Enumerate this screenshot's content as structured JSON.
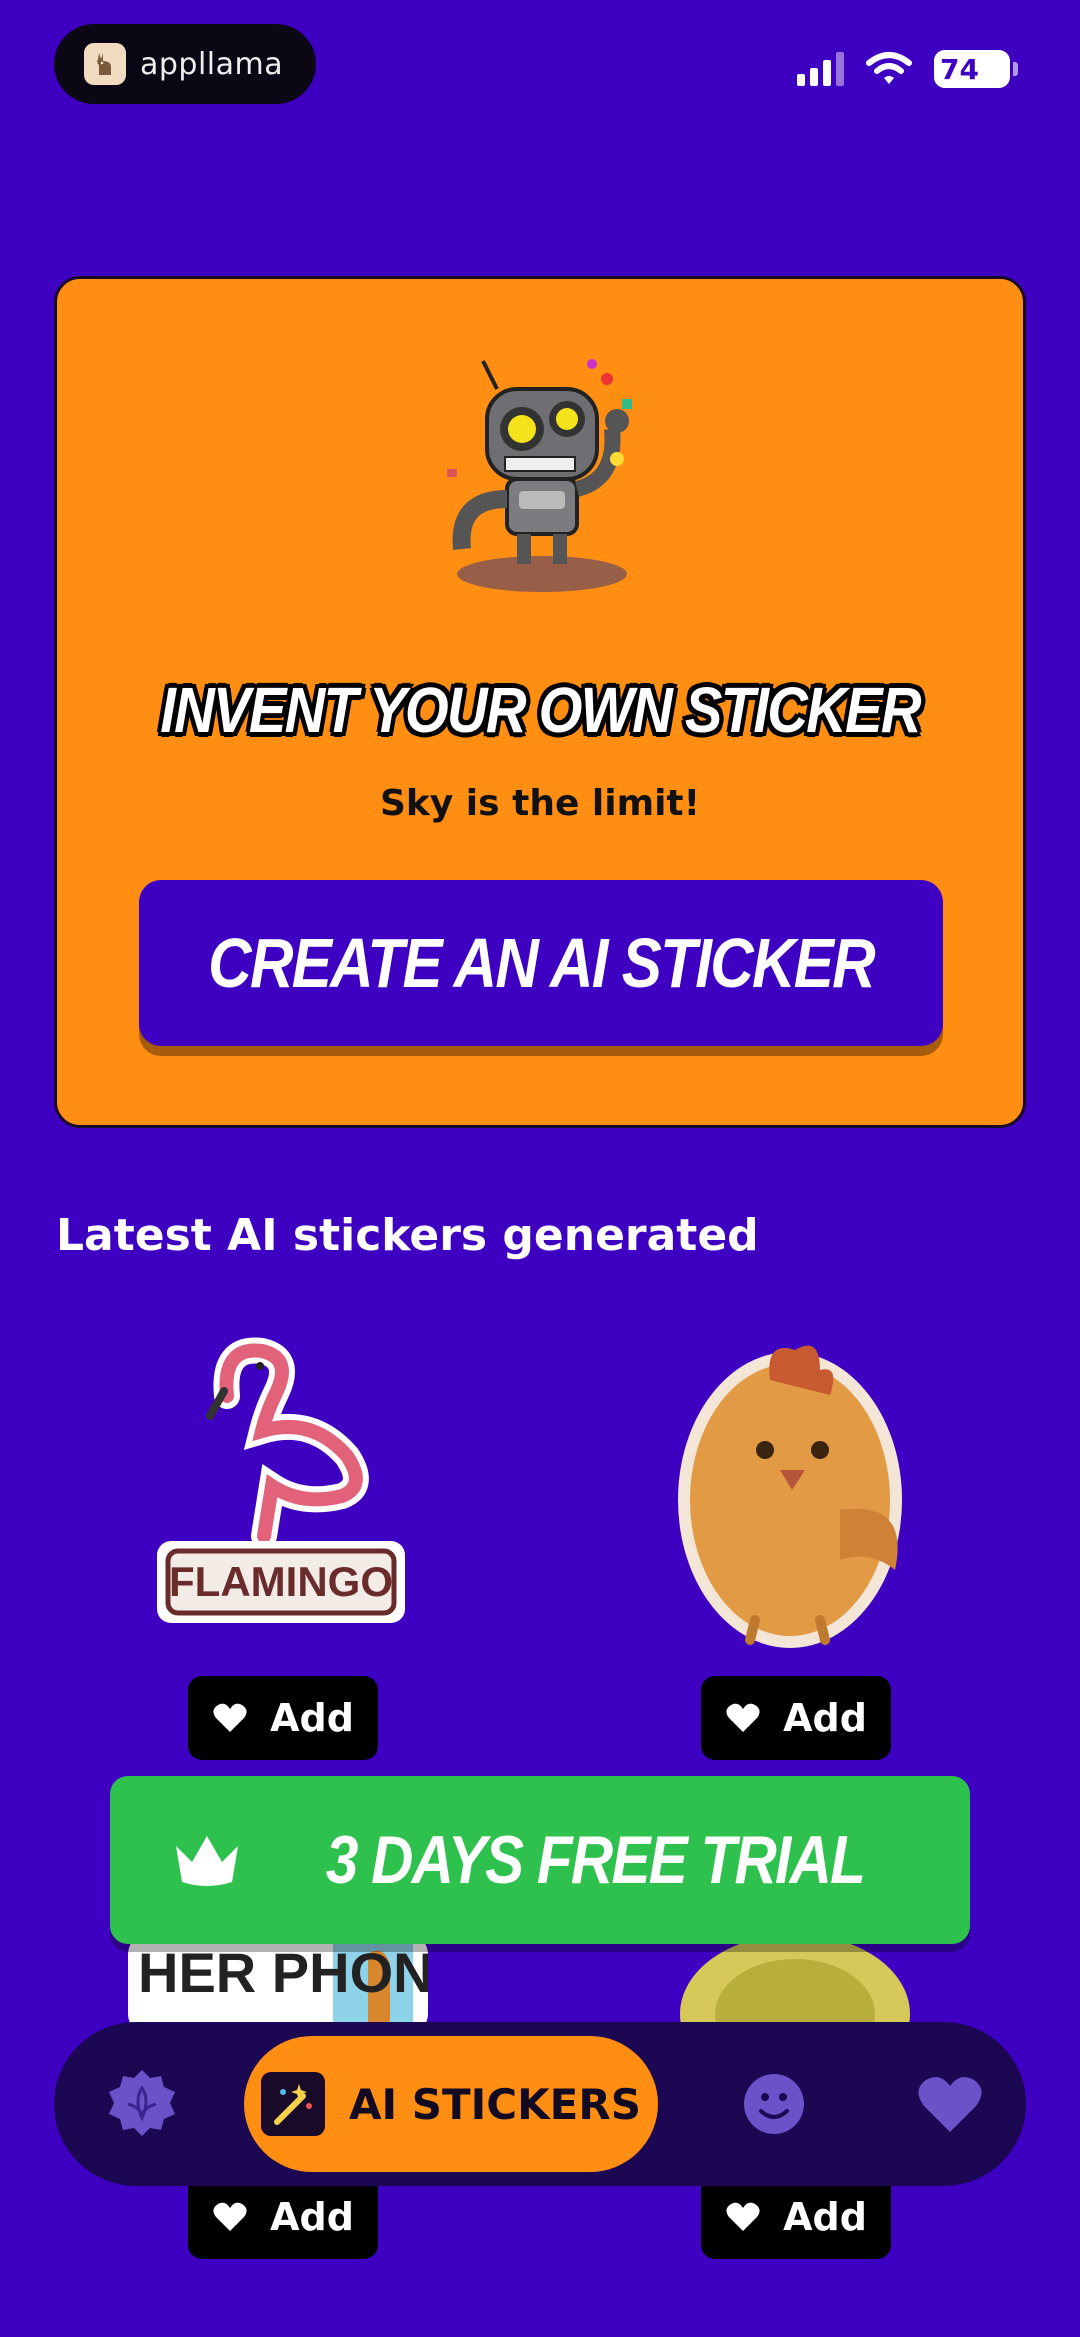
{
  "status_bar": {
    "brand_name": "appllama",
    "battery_level": "74"
  },
  "hero": {
    "title": "INVENT YOUR OWN STICKER",
    "subtitle": "Sky is the limit!",
    "cta_label": "CREATE AN AI STICKER"
  },
  "feed": {
    "section_title": "Latest AI stickers generated",
    "stickers": [
      {
        "name": "flamingo-sticker",
        "badge_text": "FLAMINGO",
        "add_label": "Add"
      },
      {
        "name": "chicken-sticker",
        "add_label": "Add"
      },
      {
        "name": "her-phone-sticker",
        "peek_text": "HER PHONE",
        "add_label": "Add"
      },
      {
        "name": "frog-sticker",
        "add_label": "Add"
      }
    ]
  },
  "trial": {
    "label": "3 DAYS FREE TRIAL",
    "icon": "crown-icon"
  },
  "nav": {
    "items": [
      {
        "icon": "badge-icon"
      },
      {
        "icon": "magic-wand-icon",
        "label": "AI STICKERS",
        "active": true
      },
      {
        "icon": "smiley-icon"
      },
      {
        "icon": "heart-icon"
      }
    ]
  },
  "colors": {
    "background": "#3E00C1",
    "hero_card": "#FF8E12",
    "trial_button": "#2EC14E",
    "nav_bar": "#1b0752",
    "nav_active": "#FF8E12"
  }
}
